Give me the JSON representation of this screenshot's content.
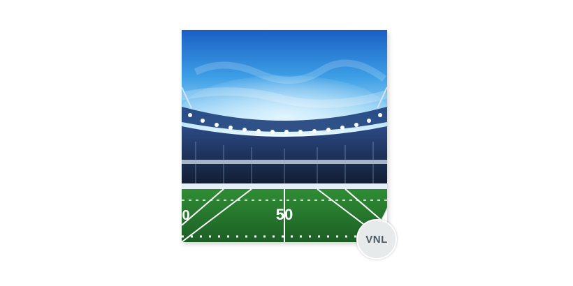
{
  "image": {
    "subject": "Stadium",
    "field_number": "50",
    "field_number_left": "0"
  },
  "badge": {
    "label": "VNL"
  },
  "colors": {
    "sky_top": "#1e66c8",
    "sky_mid": "#3fa6e8",
    "sky_glow": "#bfe8ff",
    "turf_dark": "#1f6a2a",
    "turf_light": "#3aa23e",
    "stands": "#1b2a48",
    "badge_bg": "#e6eaeb",
    "badge_text": "#4a5a63"
  }
}
